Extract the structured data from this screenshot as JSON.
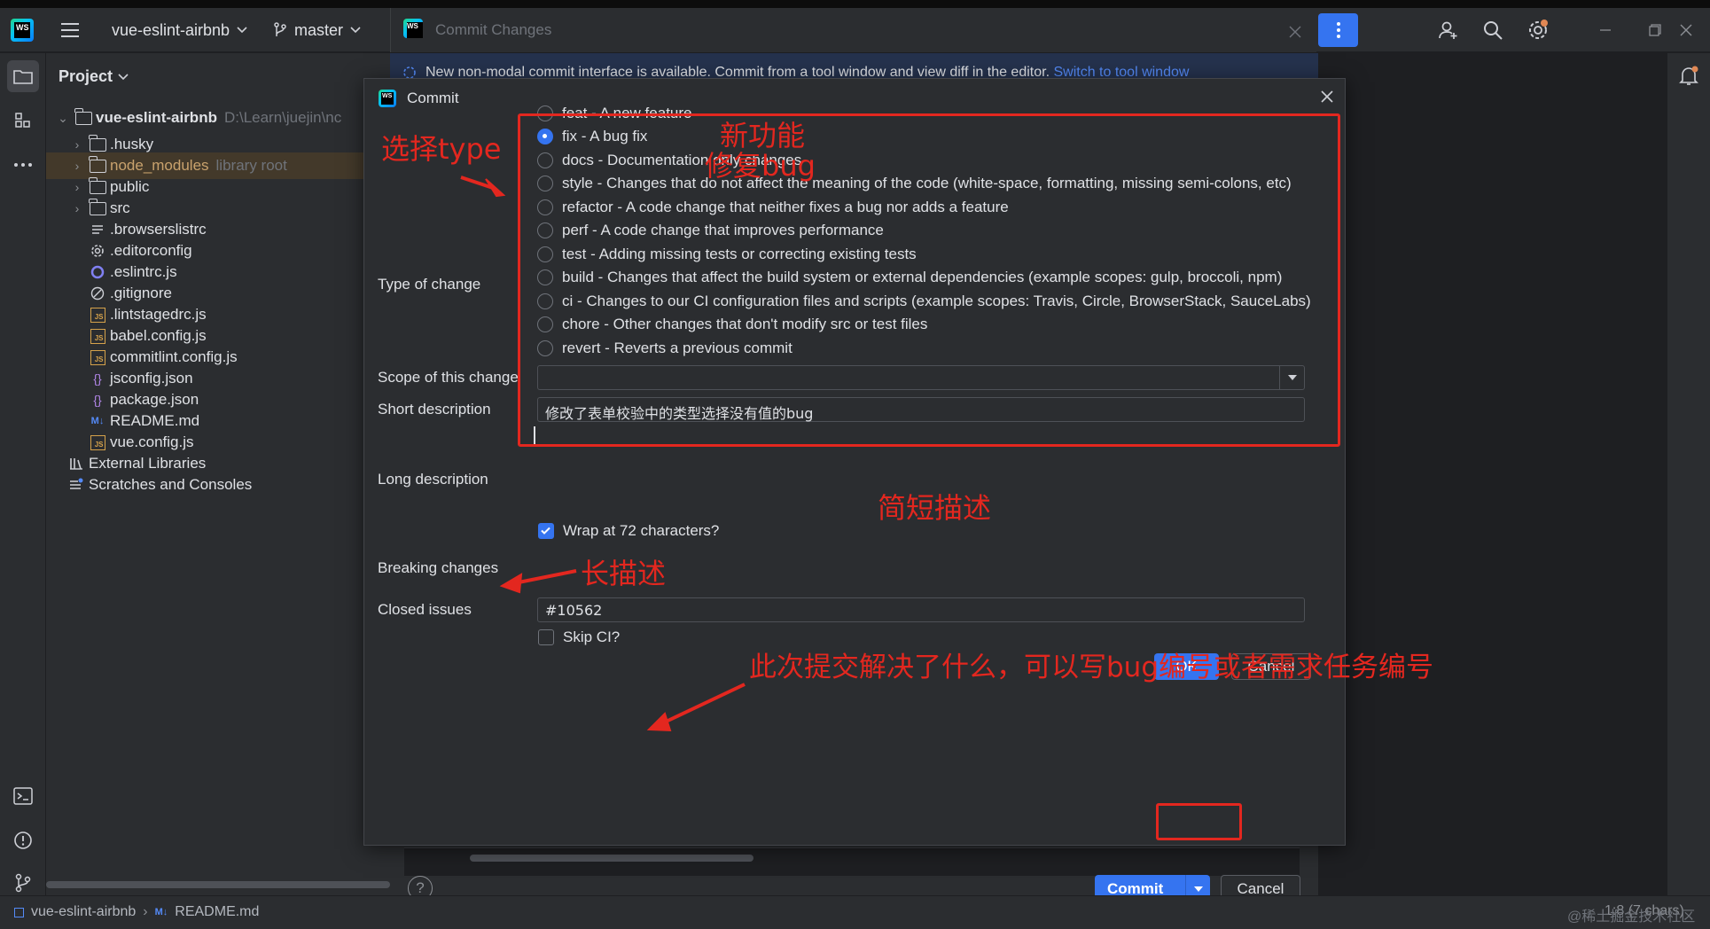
{
  "titlebar": {
    "project_name": "vue-eslint-airbnb",
    "branch": "master",
    "commit_tab_title": "Commit Changes"
  },
  "project_panel": {
    "header": "Project",
    "tree": [
      {
        "label": "vue-eslint-airbnb",
        "hint": "D:\\Learn\\juejin\\nc",
        "kind": "root"
      },
      {
        "label": ".husky",
        "kind": "folder"
      },
      {
        "label": "node_modules",
        "hint": "library root",
        "kind": "folder"
      },
      {
        "label": "public",
        "kind": "folder"
      },
      {
        "label": "src",
        "kind": "folder"
      },
      {
        "label": ".browserslistrc",
        "kind": "file"
      },
      {
        "label": ".editorconfig",
        "kind": "file"
      },
      {
        "label": ".eslintrc.js",
        "kind": "file"
      },
      {
        "label": ".gitignore",
        "kind": "file"
      },
      {
        "label": ".lintstagedrc.js",
        "kind": "js"
      },
      {
        "label": "babel.config.js",
        "kind": "js"
      },
      {
        "label": "commitlint.config.js",
        "kind": "js"
      },
      {
        "label": "jsconfig.json",
        "kind": "json"
      },
      {
        "label": "package.json",
        "kind": "json"
      },
      {
        "label": "README.md",
        "kind": "md"
      },
      {
        "label": "vue.config.js",
        "kind": "js"
      },
      {
        "label": "External Libraries",
        "kind": "lib"
      },
      {
        "label": "Scratches and Consoles",
        "kind": "scratch"
      }
    ]
  },
  "banner": {
    "text": "New non-modal commit interface is available. Commit from a tool window and view diff in the editor.",
    "link": "Switch to tool window"
  },
  "commit_window": {
    "commit_label": "Commit",
    "cancel_label": "Cancel",
    "help": "?"
  },
  "dialog": {
    "title": "Commit",
    "type_label": "Type of change",
    "types": [
      "feat - A new feature",
      "fix - A bug fix",
      "docs - Documentation only changes",
      "style - Changes that do not affect the meaning of the code (white-space, formatting, missing semi-colons, etc)",
      "refactor - A code change that neither fixes a bug nor adds a feature",
      "perf - A code change that improves performance",
      "test - Adding missing tests or correcting existing tests",
      "build - Changes that affect the build system or external dependencies (example scopes: gulp, broccoli, npm)",
      "ci - Changes to our CI configuration files and scripts (example scopes: Travis, Circle, BrowserStack, SauceLabs)",
      "chore - Other changes that don't modify src or test files",
      "revert - Reverts a previous commit"
    ],
    "selected_type": "fix - A bug fix",
    "scope_label": "Scope of this change",
    "scope_value": "",
    "short_label": "Short description",
    "short_value": "修改了表单校验中的类型选择没有值的bug",
    "long_label": "Long description",
    "wrap_label": "Wrap at 72 characters?",
    "wrap_checked": true,
    "breaking_label": "Breaking changes",
    "closed_label": "Closed issues",
    "closed_value": "#10562",
    "skip_ci_label": "Skip CI?",
    "skip_ci_checked": false,
    "ok_label": "OK",
    "cancel_label": "Cancel"
  },
  "annotations": {
    "select_type": "选择type",
    "new_feature": "新功能",
    "fix_bug": "修复bug",
    "short_desc": "简短描述",
    "long_desc": "长描述",
    "closed_note": "此次提交解决了什么，可以写bug编号或者需求任务编号",
    "color": "#e3271f"
  },
  "statusbar": {
    "crumb_project": "vue-eslint-airbnb",
    "crumb_file": "README.md",
    "position": "1:8 (7 chars)",
    "watermark": "@稀土掘金技术社区"
  },
  "colors": {
    "accent": "#3574f0",
    "panel": "#2b2d30",
    "background": "#1e1f22",
    "annotation_red": "#e3271f"
  }
}
